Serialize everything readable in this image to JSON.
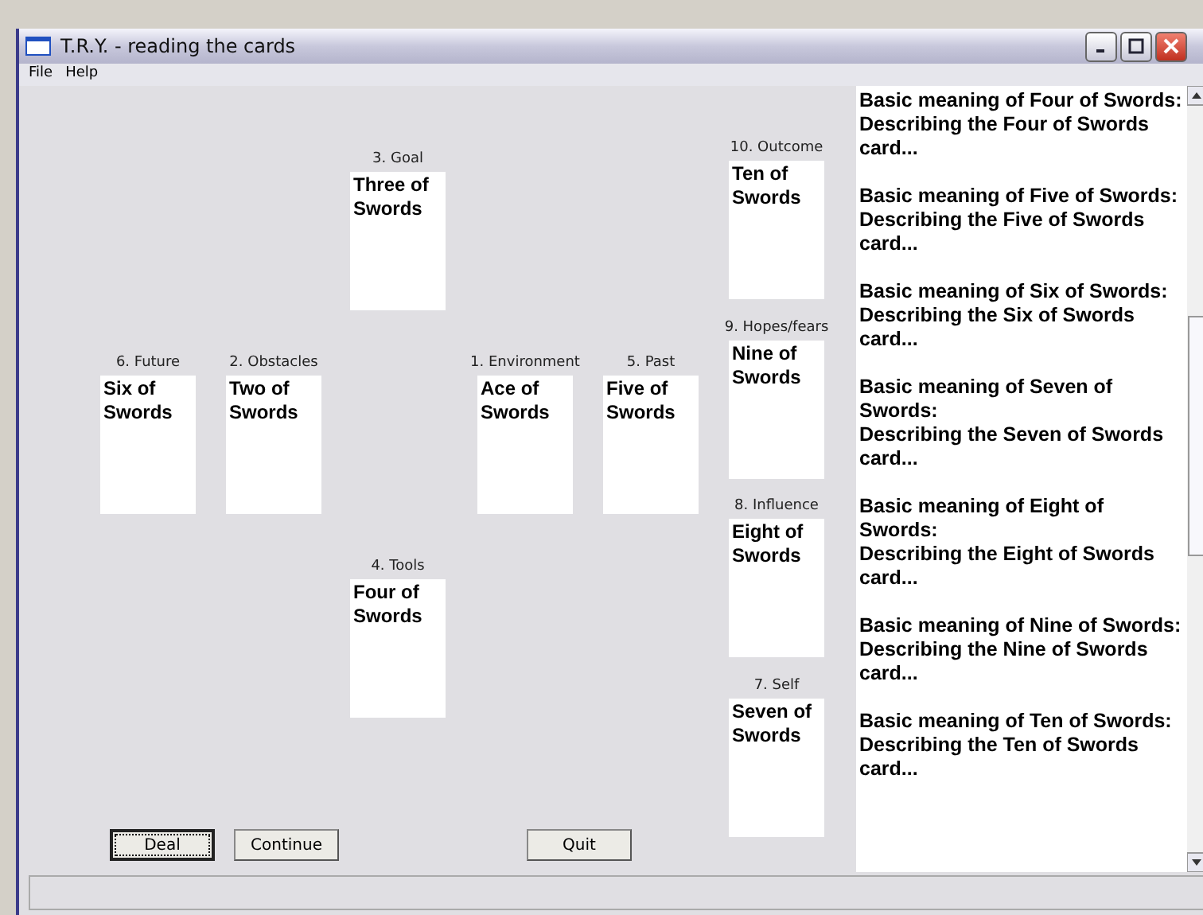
{
  "window": {
    "title": "T.R.Y. - reading the cards"
  },
  "menu": [
    "File",
    "Help"
  ],
  "spread": [
    {
      "label": "3. Goal",
      "card": "Three of Swords"
    },
    {
      "label": "10. Outcome",
      "card": "Ten of Swords"
    },
    {
      "label": "6. Future",
      "card": "Six of Swords"
    },
    {
      "label": "2. Obstacles",
      "card": "Two of Swords"
    },
    {
      "label": "1. Environment",
      "card": "Ace of Swords"
    },
    {
      "label": "5. Past",
      "card": "Five of Swords"
    },
    {
      "label": "9. Hopes/fears",
      "card": "Nine of Swords"
    },
    {
      "label": "8. Influence",
      "card": "Eight of Swords"
    },
    {
      "label": "4. Tools",
      "card": "Four of Swords"
    },
    {
      "label": "7. Self",
      "card": "Seven of Swords"
    }
  ],
  "buttons": [
    {
      "label": "Deal",
      "focused": true
    },
    {
      "label": "Continue",
      "focused": false
    },
    {
      "label": "Quit",
      "focused": false
    }
  ],
  "meanings": [
    {
      "heading": "Basic meaning of Four of Swords:",
      "text": "Describing the Four of Swords card..."
    },
    {
      "heading": "Basic meaning of Five of Swords:",
      "text": "Describing the Five of Swords card..."
    },
    {
      "heading": "Basic meaning of Six of Swords:",
      "text": "Describing the Six of Swords card..."
    },
    {
      "heading": "Basic meaning of Seven of Swords:",
      "text": "Describing the Seven of Swords card..."
    },
    {
      "heading": "Basic meaning of Eight of Swords:",
      "text": "Describing the Eight of Swords card..."
    },
    {
      "heading": "Basic meaning of Nine of Swords:",
      "text": "Describing the Nine of Swords card..."
    },
    {
      "heading": "Basic meaning of Ten of Swords:",
      "text": "Describing the Ten of Swords card..."
    }
  ]
}
